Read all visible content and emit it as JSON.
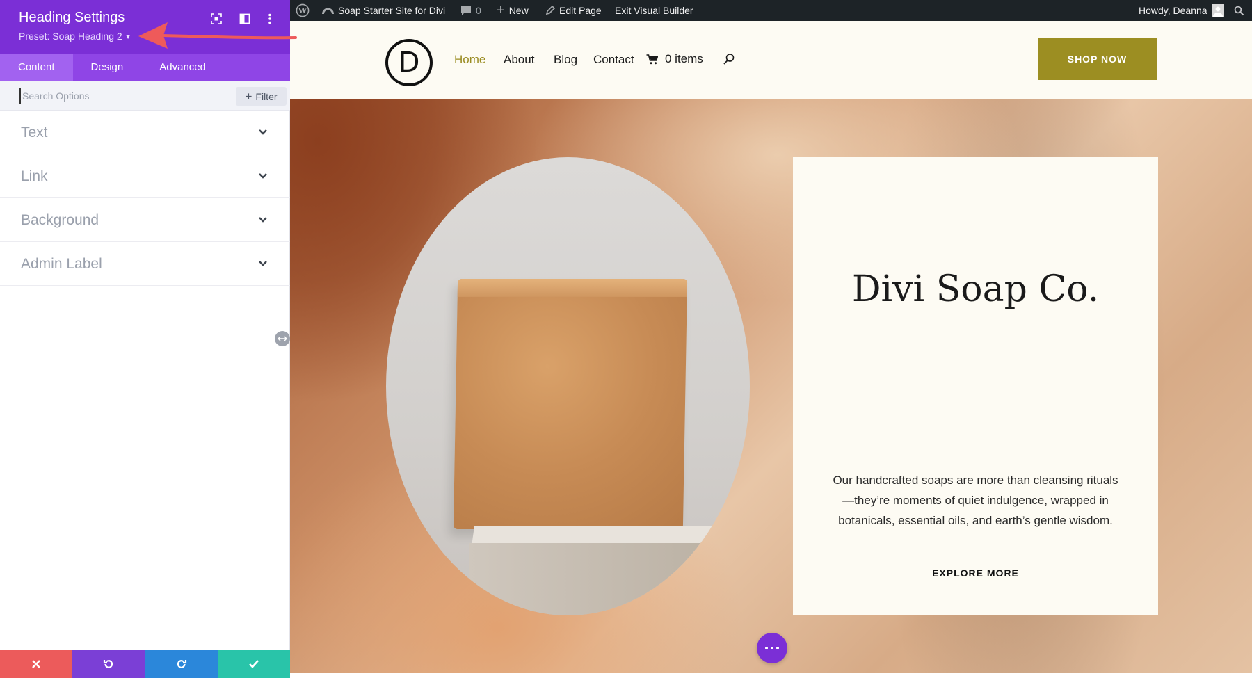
{
  "panel": {
    "title": "Heading Settings",
    "preset": "Preset: Soap Heading 2",
    "tabs": [
      {
        "label": "Content",
        "active": true
      },
      {
        "label": "Design",
        "active": false
      },
      {
        "label": "Advanced",
        "active": false
      }
    ],
    "search_placeholder": "Search Options",
    "filter_label": "Filter",
    "toggles": [
      {
        "label": "Text"
      },
      {
        "label": "Link"
      },
      {
        "label": "Background"
      },
      {
        "label": "Admin Label"
      }
    ],
    "footer_colors": [
      "#ec5b5b",
      "#7b3fd6",
      "#2b87da",
      "#29c4a9"
    ]
  },
  "adminbar": {
    "site_name": "Soap Starter Site for Divi",
    "comments_count": "0",
    "new_label": "New",
    "edit_page_label": "Edit Page",
    "exit_label": "Exit Visual Builder",
    "greeting": "Howdy, Deanna"
  },
  "header": {
    "logo_letter": "D",
    "nav": [
      {
        "label": "Home",
        "current": true
      },
      {
        "label": "About",
        "current": false
      },
      {
        "label": "Blog",
        "current": false
      },
      {
        "label": "Contact",
        "current": false
      }
    ],
    "cart_label": "0 items",
    "shop_button": "SHOP NOW"
  },
  "hero": {
    "title": "Divi Soap Co.",
    "body": "Our handcrafted soaps are more than cleansing rituals—they’re moments of quiet indulgence, wrapped in botanicals, essential oils, and earth’s gentle wisdom.",
    "cta": "EXPLORE MORE"
  },
  "colors": {
    "divi_purple": "#7b2fd6",
    "tab_bar": "#8f45e6",
    "accent_olive": "#9c8e22",
    "admin_bar": "#1d2327",
    "annotation_arrow": "#ee5a5a"
  }
}
